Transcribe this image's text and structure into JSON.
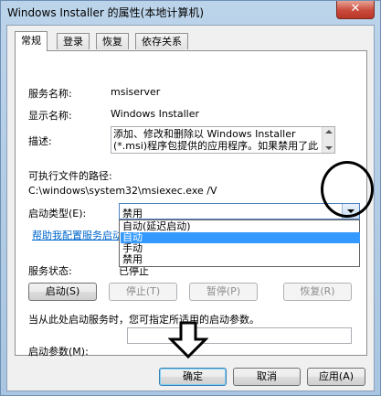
{
  "window": {
    "title": "Windows Installer 的属性(本地计算机)",
    "close_glyph": "✕"
  },
  "tabs": [
    "常规",
    "登录",
    "恢复",
    "依存关系"
  ],
  "general": {
    "service_name_label": "服务名称:",
    "service_name": "msiserver",
    "display_name_label": "显示名称:",
    "display_name": "Windows Installer",
    "description_label": "描述:",
    "description_line1": "添加、修改和删除以 Windows Installer",
    "description_line2": "(*.msi)程序包提供的应用程序。如果禁用了此",
    "exe_path_label": "可执行文件的路径:",
    "exe_path": "C:\\windows\\system32\\msiexec.exe /V",
    "startup_type_label": "启动类型(E):",
    "startup_type_value": "禁用",
    "startup_options": [
      "自动(延迟启动)",
      "自动",
      "手动",
      "禁用"
    ],
    "help_link": "帮助我配置服务启动",
    "status_label": "服务状态:",
    "status_value": "已停止",
    "start_button": "启动(S)",
    "stop_button": "停止(T)",
    "pause_button": "暂停(P)",
    "resume_button": "恢复(R)",
    "hint": "当从此处启动服务时，您可指定所适用的启动参数。",
    "params_label": "启动参数(M):",
    "params_value": ""
  },
  "footer": {
    "ok": "确定",
    "cancel": "取消",
    "apply": "应用(A)"
  },
  "selected_option_index": 1,
  "colors": {
    "accent": "#3399ff",
    "link": "#0066cc",
    "close_red": "#c94a3b"
  }
}
